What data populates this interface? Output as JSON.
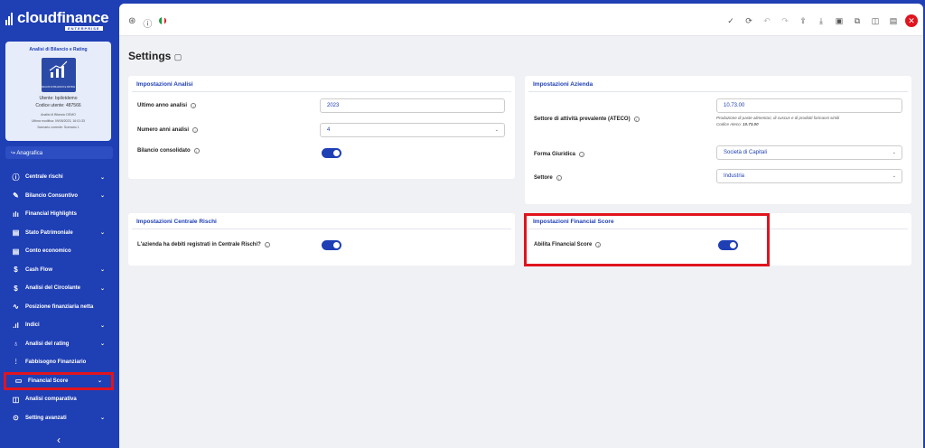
{
  "brand": {
    "name": "cloudfinance",
    "edition": "ENTERPRISE"
  },
  "card": {
    "title": "Analisi di Bilancio e Rating",
    "image_caption": "ANALISI DI BILANCIO E RATING",
    "user_line": "Utente: bpilotdemo",
    "code_line": "Codice utente: 487566",
    "doc_line": "Analisi di Bilancio DEMO",
    "modified_line": "Ultima modifica: 09/05/2023, 16:01:33",
    "scenario_line": "Scenario corrente: Scenario 1"
  },
  "sidebar": {
    "anagrafica": "Anagrafica",
    "items": [
      {
        "label": "Centrale rischi",
        "icon": "info-circle-icon",
        "chevron": true
      },
      {
        "label": "Bilancio Consuntivo",
        "icon": "edit-icon",
        "chevron": true
      },
      {
        "label": "Financial Highlights",
        "icon": "bar-chart-icon",
        "chevron": false
      },
      {
        "label": "Stato Patrimoniale",
        "icon": "document-icon",
        "chevron": true
      },
      {
        "label": "Conto economico",
        "icon": "document-icon",
        "chevron": false
      },
      {
        "label": "Cash Flow",
        "icon": "dollar-icon",
        "chevron": true
      },
      {
        "label": "Analisi del Circolante",
        "icon": "dollar-icon",
        "chevron": true
      },
      {
        "label": "Posizione finanziaria netta",
        "icon": "activity-icon",
        "chevron": false
      },
      {
        "label": "Indici",
        "icon": "bar-chart-icon",
        "chevron": true
      },
      {
        "label": "Analisi del rating",
        "icon": "award-icon",
        "chevron": true
      },
      {
        "label": "Fabbisogno Finanziario",
        "icon": "sliders-icon",
        "chevron": false
      },
      {
        "label": "Financial Score",
        "icon": "monitor-icon",
        "chevron": true,
        "highlighted": true
      },
      {
        "label": "Analisi comparativa",
        "icon": "columns-icon",
        "chevron": false
      },
      {
        "label": "Setting avanzati",
        "icon": "toggle-icon",
        "chevron": true
      }
    ]
  },
  "page": {
    "title": "Settings"
  },
  "analisi": {
    "header": "Impostazioni Analisi",
    "ultimo_anno_label": "Ultimo anno analisi",
    "ultimo_anno_value": "2023",
    "numero_anni_label": "Numero anni analisi",
    "numero_anni_value": "4",
    "bilancio_consolidato_label": "Bilancio consolidato",
    "bilancio_consolidato_on": true
  },
  "azienda": {
    "header": "Impostazioni Azienda",
    "ateco_label": "Settore di attività prevalente (ATECO)",
    "ateco_value": "10.73.00",
    "ateco_desc": "Produzione di paste alimentari, di cuscus e di prodotti farinacei simili",
    "ateco_code_prefix": "Codice Ateco: ",
    "ateco_code": "10.73.00",
    "forma_label": "Forma Giuridica",
    "forma_value": "Società di Capitali",
    "settore_label": "Settore",
    "settore_value": "Industria"
  },
  "centrale": {
    "header": "Impostazioni Centrale Rischi",
    "debiti_label": "L'azienda ha debiti registrati in Centrale Rischi?",
    "debiti_on": true
  },
  "score": {
    "header": "Impostazioni Financial Score",
    "abilita_label": "Abilita Financial Score",
    "abilita_on": true
  },
  "colors": {
    "brand": "#1f3fb5",
    "accent_red": "#e0141e"
  }
}
